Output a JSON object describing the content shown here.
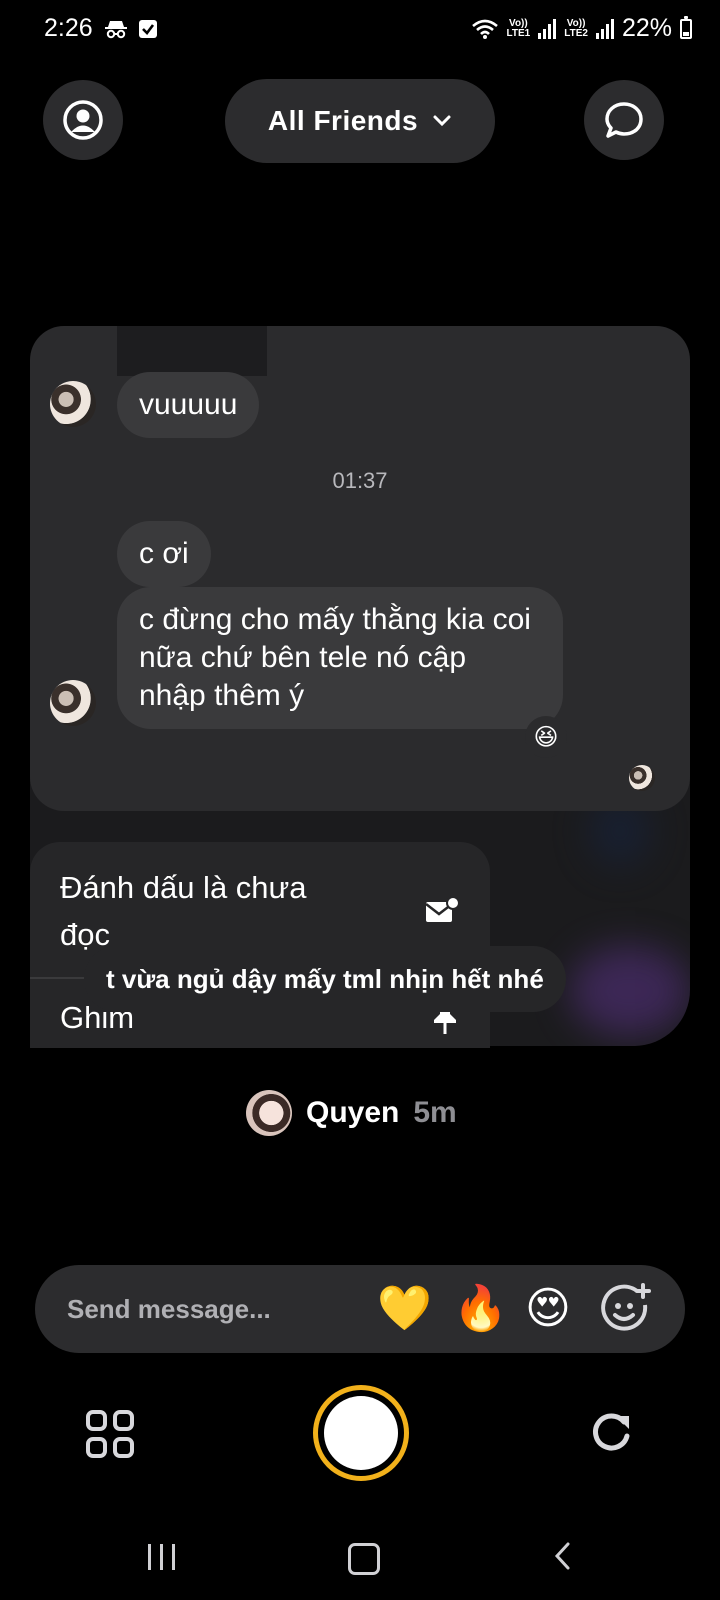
{
  "status_bar": {
    "time": "2:26",
    "network_1": [
      "Vo))",
      "LTE1"
    ],
    "network_2": [
      "Vo))",
      "LTE2"
    ],
    "battery": "22%",
    "battery_level": 0.22
  },
  "header": {
    "profile_icon": "user-circle-icon",
    "filter_label": "All Friends",
    "chat_icon": "chat-bubble-icon"
  },
  "chat": {
    "messages": [
      {
        "text": "vuuuuu"
      },
      {
        "text": "c ơi"
      },
      {
        "text": "c đừng cho mấy thằng kia coi nữa chứ bên tele nó cập nhập thêm ý"
      }
    ],
    "divider_time": "01:37",
    "reaction": "😆"
  },
  "context_menu": {
    "mark_unread": "Đánh dấu là chưa đọc",
    "mark_unread_icon": "mail-mark-icon",
    "pin": "Ghim",
    "pin_icon": "pin-icon"
  },
  "caption": "t vừa ngủ dậy mấy tml nhịn hết nhé",
  "author": {
    "name": "Quyen",
    "time": "5m"
  },
  "message_bar": {
    "placeholder": "Send message...",
    "reactions": [
      "💛",
      "🔥",
      "😍"
    ],
    "add_reaction_icon": "add-emoji-icon"
  },
  "colors": {
    "shutter_ring": "#f2b11b",
    "surface": "#2c2c2e"
  }
}
